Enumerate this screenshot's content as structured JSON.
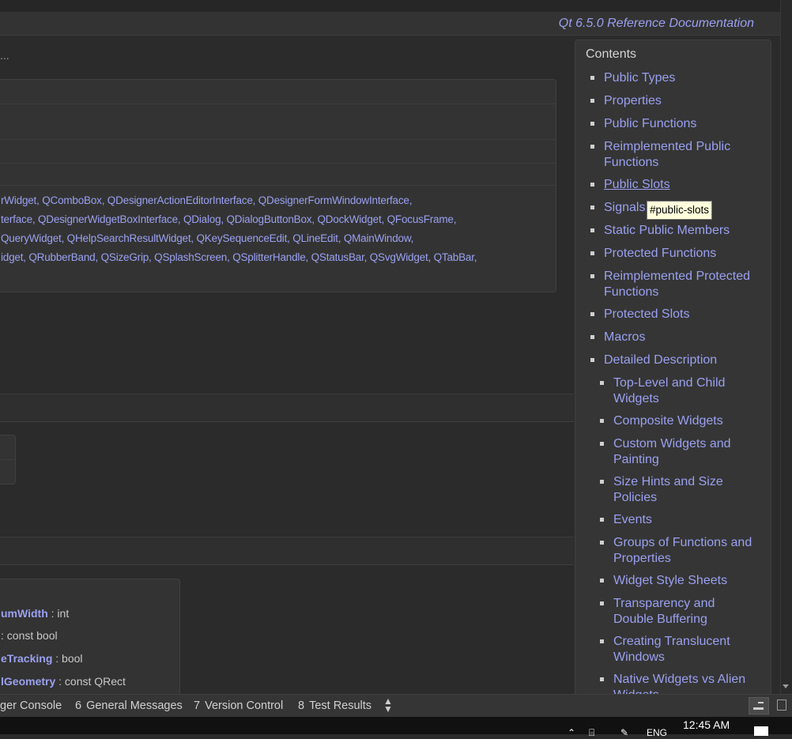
{
  "header": {
    "title": "Qt 6.5.0 Reference Documentation"
  },
  "breadcrumb_tail": "...",
  "inherited_by": [
    "rWidget, QComboBox, QDesignerActionEditorInterface, QDesignerFormWindowInterface,",
    "terface, QDesignerWidgetBoxInterface, QDialog, QDialogButtonBox, QDockWidget, QFocusFrame,",
    "QueryWidget, QHelpSearchResultWidget, QKeySequenceEdit, QLineEdit, QMainWindow,",
    "idget, QRubberBand, QSizeGrip, QSplashScreen, QSplitterHandle, QStatusBar, QSvgWidget, QTabBar,"
  ],
  "properties": [
    {
      "name": "umWidth",
      "type": " : int"
    },
    {
      "name": "",
      "type": " : const bool"
    },
    {
      "name": "eTracking",
      "type": " : bool"
    },
    {
      "name": "lGeometry",
      "type": " : const QRect"
    }
  ],
  "toc": {
    "title": "Contents",
    "items": [
      {
        "label": "Public Types",
        "lines": 1,
        "level": 1
      },
      {
        "label": "Properties",
        "lines": 1,
        "level": 1
      },
      {
        "label": "Public Functions",
        "lines": 1,
        "level": 1
      },
      {
        "label": "Reimplemented Public\nFunctions",
        "lines": 2,
        "level": 1
      },
      {
        "label": "Public Slots",
        "lines": 1,
        "level": 1,
        "active": true
      },
      {
        "label": "Signals",
        "lines": 1,
        "level": 1
      },
      {
        "label": "Static Public Members",
        "lines": 1,
        "level": 1
      },
      {
        "label": "Protected Functions",
        "lines": 1,
        "level": 1
      },
      {
        "label": "Reimplemented Protected\nFunctions",
        "lines": 2,
        "level": 1
      },
      {
        "label": "Protected Slots",
        "lines": 1,
        "level": 1
      },
      {
        "label": "Macros",
        "lines": 1,
        "level": 1
      },
      {
        "label": "Detailed Description",
        "lines": 1,
        "level": 1
      },
      {
        "label": "Top-Level and Child\nWidgets",
        "lines": 2,
        "level": 2
      },
      {
        "label": "Composite Widgets",
        "lines": 1,
        "level": 2
      },
      {
        "label": "Custom Widgets and\nPainting",
        "lines": 2,
        "level": 2
      },
      {
        "label": "Size Hints and Size\nPolicies",
        "lines": 2,
        "level": 2
      },
      {
        "label": "Events",
        "lines": 1,
        "level": 2
      },
      {
        "label": "Groups of Functions and\nProperties",
        "lines": 2,
        "level": 2
      },
      {
        "label": "Widget Style Sheets",
        "lines": 1,
        "level": 2
      },
      {
        "label": "Transparency and\nDouble Buffering",
        "lines": 2,
        "level": 2
      },
      {
        "label": "Creating Translucent\nWindows",
        "lines": 2,
        "level": 2
      },
      {
        "label": "Native Widgets vs Alien\nWidgets",
        "lines": 2,
        "level": 2
      }
    ]
  },
  "tooltip": "#public-slots",
  "status_bar": {
    "items": [
      {
        "num": "",
        "label": "ger Console"
      },
      {
        "num": "6",
        "label": "General Messages"
      },
      {
        "num": "7",
        "label": "Version Control"
      },
      {
        "num": "8",
        "label": "Test Results"
      }
    ],
    "spinner": "▲\n▼"
  },
  "taskbar": {
    "time": "12:45 AM",
    "lang": "ENG"
  },
  "colors": {
    "link": "#9aa0f0",
    "background": "#2b2b2b",
    "panel": "#333333"
  }
}
